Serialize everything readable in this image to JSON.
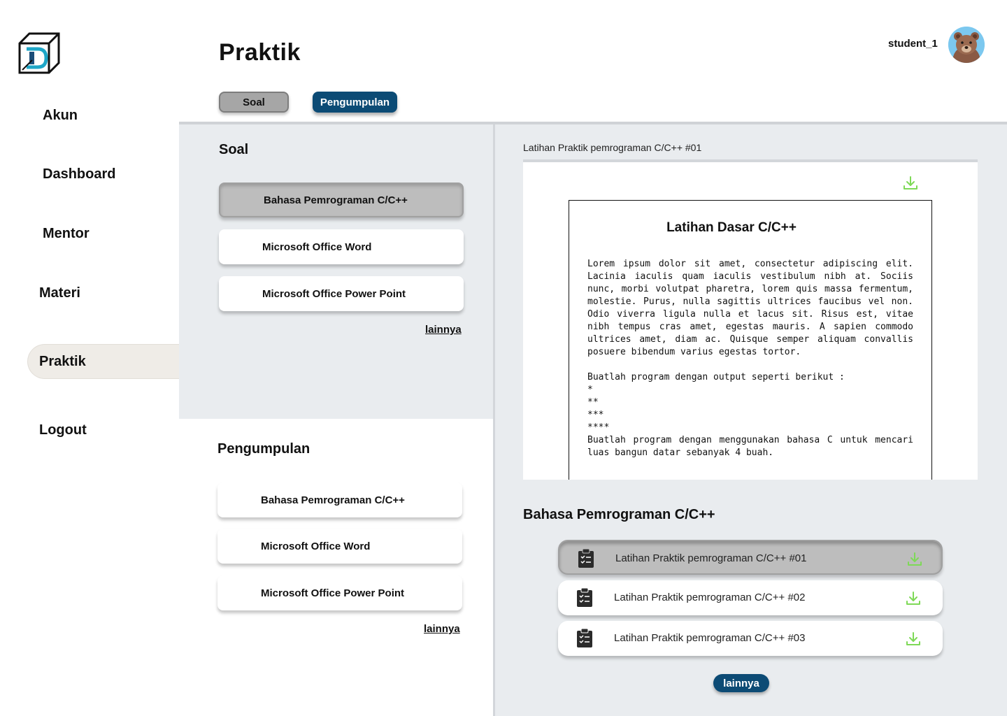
{
  "sidebar": {
    "items": [
      {
        "label": "Akun",
        "active": false
      },
      {
        "label": "Dashboard",
        "active": false
      },
      {
        "label": "Mentor",
        "active": false
      },
      {
        "label": "Materi",
        "active": false
      },
      {
        "label": "Praktik",
        "active": true
      },
      {
        "label": "Logout",
        "active": false
      }
    ]
  },
  "header": {
    "title": "Praktik",
    "username": "student_1",
    "avatar_icon": "bear-avatar"
  },
  "tabs": [
    {
      "label": "Soal",
      "active": true
    },
    {
      "label": "Pengumpulan",
      "active": false
    }
  ],
  "soal": {
    "title": "Soal",
    "items": [
      "Bahasa Pemrograman C/C++",
      "Microsoft Office Word",
      "Microsoft Office Power Point"
    ],
    "selected": 0,
    "more": "lainnya"
  },
  "pengumpulan": {
    "title": "Pengumpulan",
    "items": [
      "Bahasa Pemrograman C/C++",
      "Microsoft Office Word",
      "Microsoft Office Power Point"
    ],
    "more": "lainnya"
  },
  "preview": {
    "caption": "Latihan Praktik pemrograman C/C++ #01",
    "doc_title": "Latihan Dasar C/C++",
    "paragraph": "Lorem ipsum dolor sit amet, consectetur adipiscing elit. Lacinia iaculis quam iaculis vestibulum nibh at. Sociis nunc, morbi volutpat pharetra, lorem quis massa fermentum, molestie. Purus, nulla sagittis ultrices faucibus vel non. Odio viverra ligula nulla et lacus sit. Risus est, vitae nibh tempus cras amet, egestas mauris. A sapien commodo ultrices amet, diam ac. Quisque semper aliquam convallis posuere bibendum varius egestas tortor.",
    "task1": "Buatlah program dengan output seperti berikut :",
    "pattern": [
      "*",
      "**",
      "***",
      "****"
    ],
    "task2": "Buatlah program dengan menggunakan bahasa C untuk mencari luas bangun datar sebanyak 4 buah."
  },
  "files": {
    "title": "Bahasa Pemrograman C/C++",
    "items": [
      {
        "name": "Latihan Praktik pemrograman C/C++ #01",
        "active": true
      },
      {
        "name": "Latihan Praktik pemrograman C/C++ #02",
        "active": false
      },
      {
        "name": "Latihan Praktik pemrograman C/C++ #03",
        "active": false
      }
    ],
    "more": "lainnya"
  },
  "colors": {
    "accent": "#0c4b75",
    "download_icon": "#7ed957",
    "panel_bg": "#e9ecef",
    "active_nav_bg": "#efece7"
  }
}
